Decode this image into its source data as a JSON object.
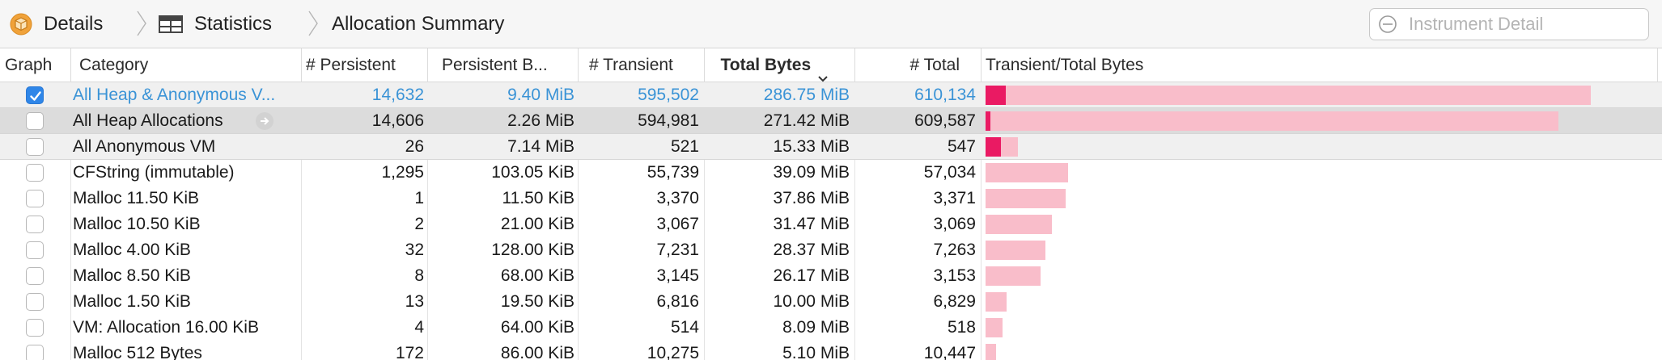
{
  "breadcrumb": {
    "items": [
      {
        "label": "Details",
        "icon": "instrument-box-icon"
      },
      {
        "label": "Statistics",
        "icon": "table-grid-icon"
      },
      {
        "label": "Allocation Summary"
      }
    ]
  },
  "search": {
    "placeholder": "Instrument Detail",
    "icon": "filter-icon"
  },
  "table": {
    "sort_column": "Total Bytes",
    "sort_direction": "descending",
    "headers": [
      "Graph",
      "Category",
      "# Persistent",
      "Persistent B...",
      "# Transient",
      "Total Bytes",
      "# Total",
      "Transient/Total Bytes"
    ],
    "rows": [
      {
        "graph": true,
        "category": "All Heap & Anonymous V...",
        "persistent": "14,632",
        "persistent_bytes": "9.40 MiB",
        "transient": "595,502",
        "total_bytes": "286.75 MiB",
        "total": "610,134",
        "bar_total_fraction": 1.0,
        "bar_persistent_fraction": 0.033
      },
      {
        "graph": false,
        "category": "All Heap Allocations",
        "persistent": "14,606",
        "persistent_bytes": "2.26 MiB",
        "transient": "594,981",
        "total_bytes": "271.42 MiB",
        "total": "609,587",
        "bar_total_fraction": 0.947,
        "bar_persistent_fraction": 0.008
      },
      {
        "graph": false,
        "category": "All Anonymous VM",
        "persistent": "26",
        "persistent_bytes": "7.14 MiB",
        "transient": "521",
        "total_bytes": "15.33 MiB",
        "total": "547",
        "bar_total_fraction": 0.053,
        "bar_persistent_fraction": 0.025
      },
      {
        "graph": false,
        "category": "CFString (immutable)",
        "persistent": "1,295",
        "persistent_bytes": "103.05 KiB",
        "transient": "55,739",
        "total_bytes": "39.09 MiB",
        "total": "57,034",
        "bar_total_fraction": 0.136,
        "bar_persistent_fraction": 0
      },
      {
        "graph": false,
        "category": "Malloc 11.50 KiB",
        "persistent": "1",
        "persistent_bytes": "11.50 KiB",
        "transient": "3,370",
        "total_bytes": "37.86 MiB",
        "total": "3,371",
        "bar_total_fraction": 0.132,
        "bar_persistent_fraction": 0
      },
      {
        "graph": false,
        "category": "Malloc 10.50 KiB",
        "persistent": "2",
        "persistent_bytes": "21.00 KiB",
        "transient": "3,067",
        "total_bytes": "31.47 MiB",
        "total": "3,069",
        "bar_total_fraction": 0.11,
        "bar_persistent_fraction": 0
      },
      {
        "graph": false,
        "category": "Malloc 4.00 KiB",
        "persistent": "32",
        "persistent_bytes": "128.00 KiB",
        "transient": "7,231",
        "total_bytes": "28.37 MiB",
        "total": "7,263",
        "bar_total_fraction": 0.099,
        "bar_persistent_fraction": 0
      },
      {
        "graph": false,
        "category": "Malloc 8.50 KiB",
        "persistent": "8",
        "persistent_bytes": "68.00 KiB",
        "transient": "3,145",
        "total_bytes": "26.17 MiB",
        "total": "3,153",
        "bar_total_fraction": 0.091,
        "bar_persistent_fraction": 0
      },
      {
        "graph": false,
        "category": "Malloc 1.50 KiB",
        "persistent": "13",
        "persistent_bytes": "19.50 KiB",
        "transient": "6,816",
        "total_bytes": "10.00 MiB",
        "total": "6,829",
        "bar_total_fraction": 0.035,
        "bar_persistent_fraction": 0
      },
      {
        "graph": false,
        "category": "VM: Allocation 16.00 KiB",
        "persistent": "4",
        "persistent_bytes": "64.00 KiB",
        "transient": "514",
        "total_bytes": "8.09 MiB",
        "total": "518",
        "bar_total_fraction": 0.028,
        "bar_persistent_fraction": 0
      },
      {
        "graph": false,
        "category": "Malloc 512 Bytes",
        "persistent": "172",
        "persistent_bytes": "86.00 KiB",
        "transient": "10,275",
        "total_bytes": "5.10 MiB",
        "total": "10,447",
        "bar_total_fraction": 0.018,
        "bar_persistent_fraction": 0
      }
    ]
  },
  "colors": {
    "selected_row_text": "#3a93d6",
    "bar_total": "#f9bdca",
    "bar_persistent": "#ea1a63",
    "checkbox_checked": "#2f86e8"
  }
}
